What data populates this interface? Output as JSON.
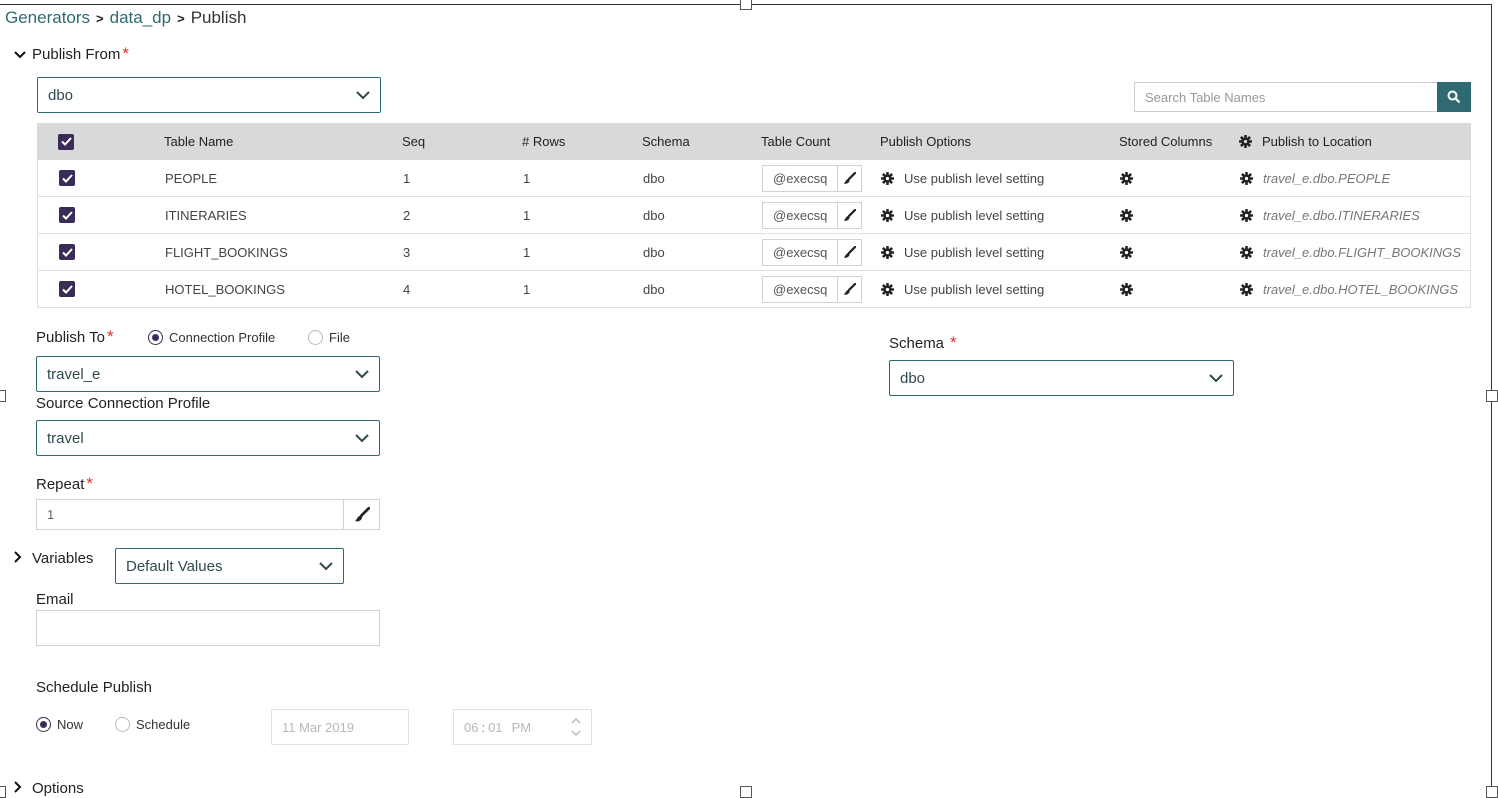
{
  "breadcrumb": {
    "item1": "Generators",
    "item2": "data_dp",
    "current": "Publish"
  },
  "publish_from": {
    "label": "Publish From",
    "required_mark": "*",
    "schema_select": "dbo"
  },
  "search": {
    "placeholder": "Search Table Names"
  },
  "table": {
    "headers": {
      "table_name": "Table Name",
      "seq": "Seq",
      "rows": "# Rows",
      "schema": "Schema",
      "table_count": "Table Count",
      "publish_options": "Publish Options",
      "stored_columns": "Stored Columns",
      "publish_to_location": "Publish to Location"
    },
    "rows": [
      {
        "name": "PEOPLE",
        "seq": "1",
        "rows": "1",
        "schema": "dbo",
        "table_count": "@execsq",
        "publish_option": "Use publish level setting",
        "location": "travel_e.dbo.PEOPLE"
      },
      {
        "name": "ITINERARIES",
        "seq": "2",
        "rows": "1",
        "schema": "dbo",
        "table_count": "@execsq",
        "publish_option": "Use publish level setting",
        "location": "travel_e.dbo.ITINERARIES"
      },
      {
        "name": "FLIGHT_BOOKINGS",
        "seq": "3",
        "rows": "1",
        "schema": "dbo",
        "table_count": "@execsq",
        "publish_option": "Use publish level setting",
        "location": "travel_e.dbo.FLIGHT_BOOKINGS"
      },
      {
        "name": "HOTEL_BOOKINGS",
        "seq": "4",
        "rows": "1",
        "schema": "dbo",
        "table_count": "@execsq",
        "publish_option": "Use publish level setting",
        "location": "travel_e.dbo.HOTEL_BOOKINGS"
      }
    ]
  },
  "publish_to": {
    "label": "Publish To",
    "required_mark": "*",
    "option_connection": "Connection Profile",
    "option_file": "File",
    "selected": "Connection Profile",
    "profile_select": "travel_e"
  },
  "schema": {
    "label": "Schema",
    "required_mark": "*",
    "select": "dbo"
  },
  "source_connection": {
    "label": "Source Connection Profile",
    "select": "travel"
  },
  "repeat": {
    "label": "Repeat",
    "required_mark": "*",
    "value": "1"
  },
  "variables": {
    "label": "Variables",
    "select": "Default Values"
  },
  "email": {
    "label": "Email",
    "value": ""
  },
  "schedule": {
    "label": "Schedule Publish",
    "option_now": "Now",
    "option_schedule": "Schedule",
    "selected": "Now",
    "date": "11 Mar 2019",
    "hour": "06",
    "minute": "01",
    "ampm": "PM"
  },
  "options": {
    "label": "Options"
  },
  "colors": {
    "accent": "#2f6a73",
    "checkbox": "#3b2b59",
    "required": "#d9342b",
    "header_bg": "#d7d9db"
  }
}
